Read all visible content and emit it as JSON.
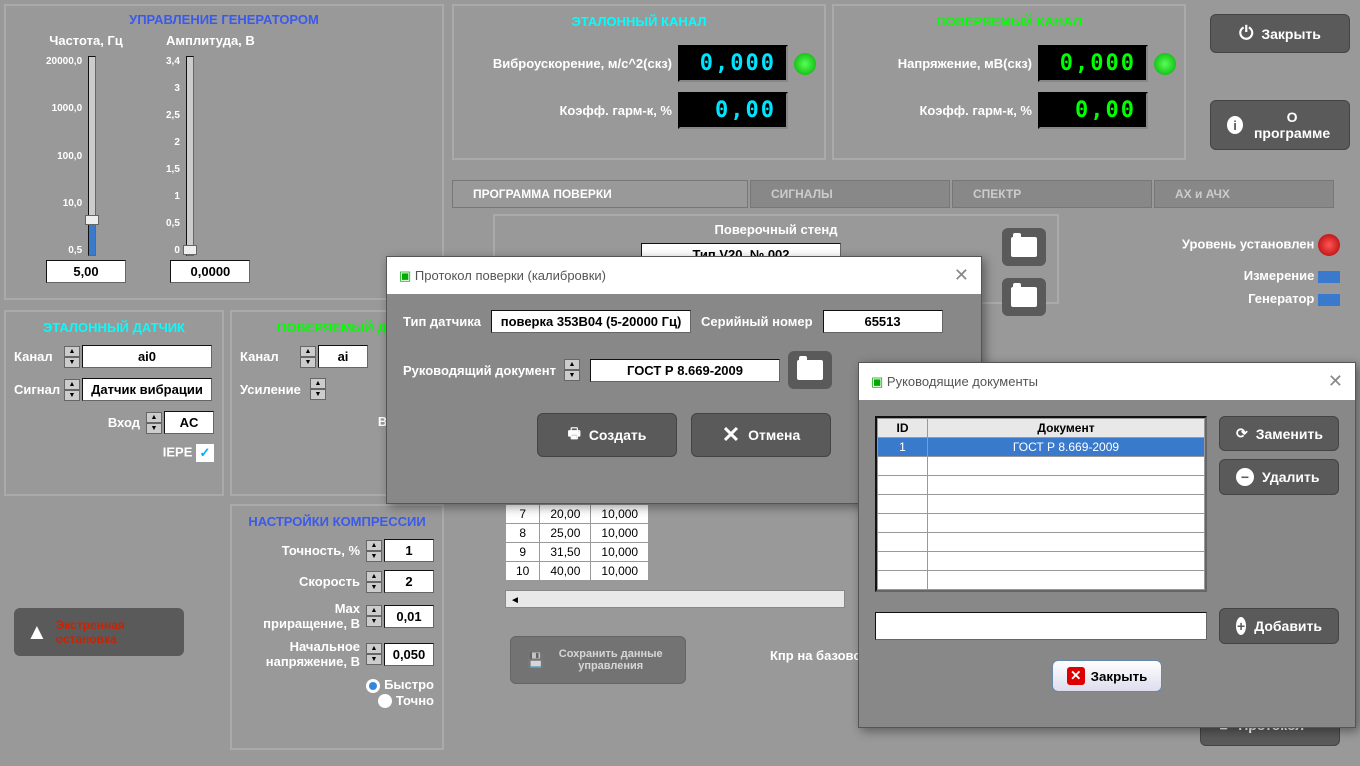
{
  "generator": {
    "title": "УПРАВЛЕНИЕ ГЕНЕРАТОРОМ",
    "freq_label": "Частота, Гц",
    "amp_label": "Амплитуда, В",
    "freq_value": "5,00",
    "amp_value": "0,0000",
    "freq_scale": [
      "20000,0",
      "1000,0",
      "100,0",
      "10,0",
      "0,5"
    ],
    "amp_scale": [
      "3,4",
      "3",
      "2,5",
      "2",
      "1,5",
      "1",
      "0,5",
      "0"
    ]
  },
  "ref_channel": {
    "title": "ЭТАЛОННЫЙ КАНАЛ",
    "accel_label": "Виброускорение, м/с^2(скз)",
    "accel_value": "0,000",
    "thd_label": "Коэфф. гарм-к, %",
    "thd_value": "0,00"
  },
  "test_channel": {
    "title": "ПОВЕРЯЕМЫЙ КАНАЛ",
    "volt_label": "Напряжение, мВ(скз)",
    "volt_value": "0,000",
    "thd_label": "Коэфф. гарм-к, %",
    "thd_value": "0,00"
  },
  "top_buttons": {
    "close": "Закрыть",
    "about": "О программе"
  },
  "tabs": {
    "program": "ПРОГРАММА ПОВЕРКИ",
    "signals": "СИГНАЛЫ",
    "spectrum": "СПЕКТР",
    "ax": "АХ и АЧХ"
  },
  "ref_sensor": {
    "title": "ЭТАЛОННЫЙ ДАТЧИК",
    "channel_label": "Канал",
    "channel_value": "ai0",
    "signal_label": "Сигнал",
    "signal_value": "Датчик вибрации",
    "input_label": "Вход",
    "input_value": "AC",
    "iepe_label": "IEPE"
  },
  "test_sensor": {
    "title": "ПОВЕРЯЕМЫЙ Д...",
    "channel_label": "Канал",
    "channel_value": "ai",
    "gain_label": "Усиление",
    "input_label": "Вход"
  },
  "compression": {
    "title": "НАСТРОЙКИ КОМПРЕССИИ",
    "accuracy_label": "Точность, %",
    "accuracy_value": "1",
    "speed_label": "Скорость",
    "speed_value": "2",
    "max_incr_label": "Max приращение, В",
    "max_incr_value": "0,01",
    "init_volt_label": "Начальное напряжение, В",
    "init_volt_value": "0,050",
    "fast": "Быстро",
    "precise": "Точно"
  },
  "emergency_stop": "Экстренная остановка",
  "stand": {
    "title": "Поверочный стенд",
    "value": "Тип V20, № 002"
  },
  "status": {
    "level_set": "Уровень установлен",
    "measurement": "Измерение",
    "generator": "Генератор"
  },
  "save_btn": "Сохранить данные управления",
  "kpr_label": "Кпр на базово",
  "protocol_btn": "Протокол",
  "data_rows": [
    {
      "n": "7",
      "f": "20,00",
      "v": "10,000"
    },
    {
      "n": "8",
      "f": "25,00",
      "v": "10,000"
    },
    {
      "n": "9",
      "f": "31,50",
      "v": "10,000"
    },
    {
      "n": "10",
      "f": "40,00",
      "v": "10,000"
    }
  ],
  "dialog1": {
    "title": "Протокол поверки (калибровки)",
    "sensor_type_label": "Тип датчика",
    "sensor_type_value": "поверка 353B04 (5-20000 Гц)",
    "serial_label": "Серийный номер",
    "serial_value": "65513",
    "doc_label": "Руководящий документ",
    "doc_value": "ГОСТ Р 8.669-2009",
    "create": "Создать",
    "cancel": "Отмена"
  },
  "dialog2": {
    "title": "Руководящие документы",
    "col_id": "ID",
    "col_doc": "Документ",
    "rows": [
      {
        "id": "1",
        "doc": "ГОСТ Р 8.669-2009"
      }
    ],
    "replace": "Заменить",
    "delete": "Удалить",
    "add": "Добавить",
    "close": "Закрыть"
  }
}
